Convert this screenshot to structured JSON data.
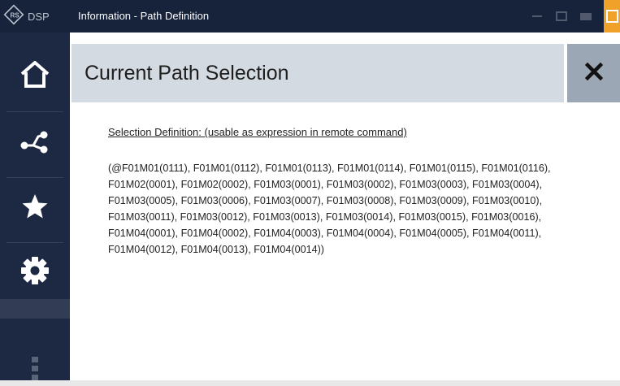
{
  "app": {
    "logo_text": "DSP",
    "window_title": "Information - Path Definition"
  },
  "sidebar": {
    "items": [
      {
        "name": "home",
        "icon": "home-icon"
      },
      {
        "name": "path",
        "icon": "path-icon"
      },
      {
        "name": "favorites",
        "icon": "star-icon"
      },
      {
        "name": "settings",
        "icon": "gear-icon"
      }
    ]
  },
  "panel": {
    "title": "Current Path Selection",
    "selection_label": "Selection Definition: (usable as expression in remote command)",
    "selection_text": "(@F01M01(0111), F01M01(0112), F01M01(0113), F01M01(0114), F01M01(0115), F01M01(0116), F01M02(0001), F01M02(0002), F01M03(0001), F01M03(0002), F01M03(0003), F01M03(0004), F01M03(0005), F01M03(0006), F01M03(0007), F01M03(0008), F01M03(0009), F01M03(0010), F01M03(0011), F01M03(0012), F01M03(0013), F01M03(0014), F01M03(0015), F01M03(0016), F01M04(0001), F01M04(0002), F01M04(0003), F01M04(0004), F01M04(0005), F01M04(0011), F01M04(0012), F01M04(0013), F01M04(0014))"
  },
  "colors": {
    "titlebar": "#17233a",
    "sidebar": "#1d2942",
    "accent": "#f0a12a",
    "header": "#d4dae1"
  }
}
